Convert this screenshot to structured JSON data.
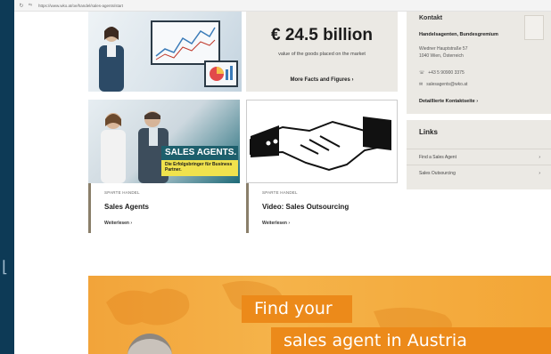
{
  "browser": {
    "url": "https://www.wko.at/oe/handel/sales-agents/start"
  },
  "stat_box": {
    "value": "€ 24.5 billion",
    "description": "value of the goods placed on the market",
    "link": "More Facts and Figures"
  },
  "contact": {
    "heading": "Kontakt",
    "org": "Handelsagenten, Bundesgremium",
    "address_line1": "Wiedner Hauptstraße 57",
    "address_line2": "1040 Wien, Österreich",
    "phone": "+43 5 90900 3375",
    "email": "salesagents@wko.at",
    "cta": "Detaillierte Kontaktseite"
  },
  "links": {
    "heading": "Links",
    "items": [
      {
        "label": "Find a Sales Agent"
      },
      {
        "label": "Sales Outsourcing"
      }
    ]
  },
  "cards": [
    {
      "category": "SPARTE HANDEL",
      "title": "Sales Agents",
      "more": "Weiterlesen",
      "badge_title": "SALES AGENTS.",
      "badge_sub": "Die Erfolgsbringer für Business Partner."
    },
    {
      "category": "SPARTE HANDEL",
      "title": "Video: Sales Outsourcing",
      "more": "Weiterlesen"
    }
  ],
  "banner": {
    "line1": "Find your",
    "line2": "sales agent in Austria"
  },
  "colors": {
    "background": "#0d3a56",
    "panel": "#ebe9e4",
    "banner": "#f5b34a",
    "banner_accent": "#ec8a1a",
    "teal": "#1d5f6c",
    "yellow": "#f0e24d"
  }
}
